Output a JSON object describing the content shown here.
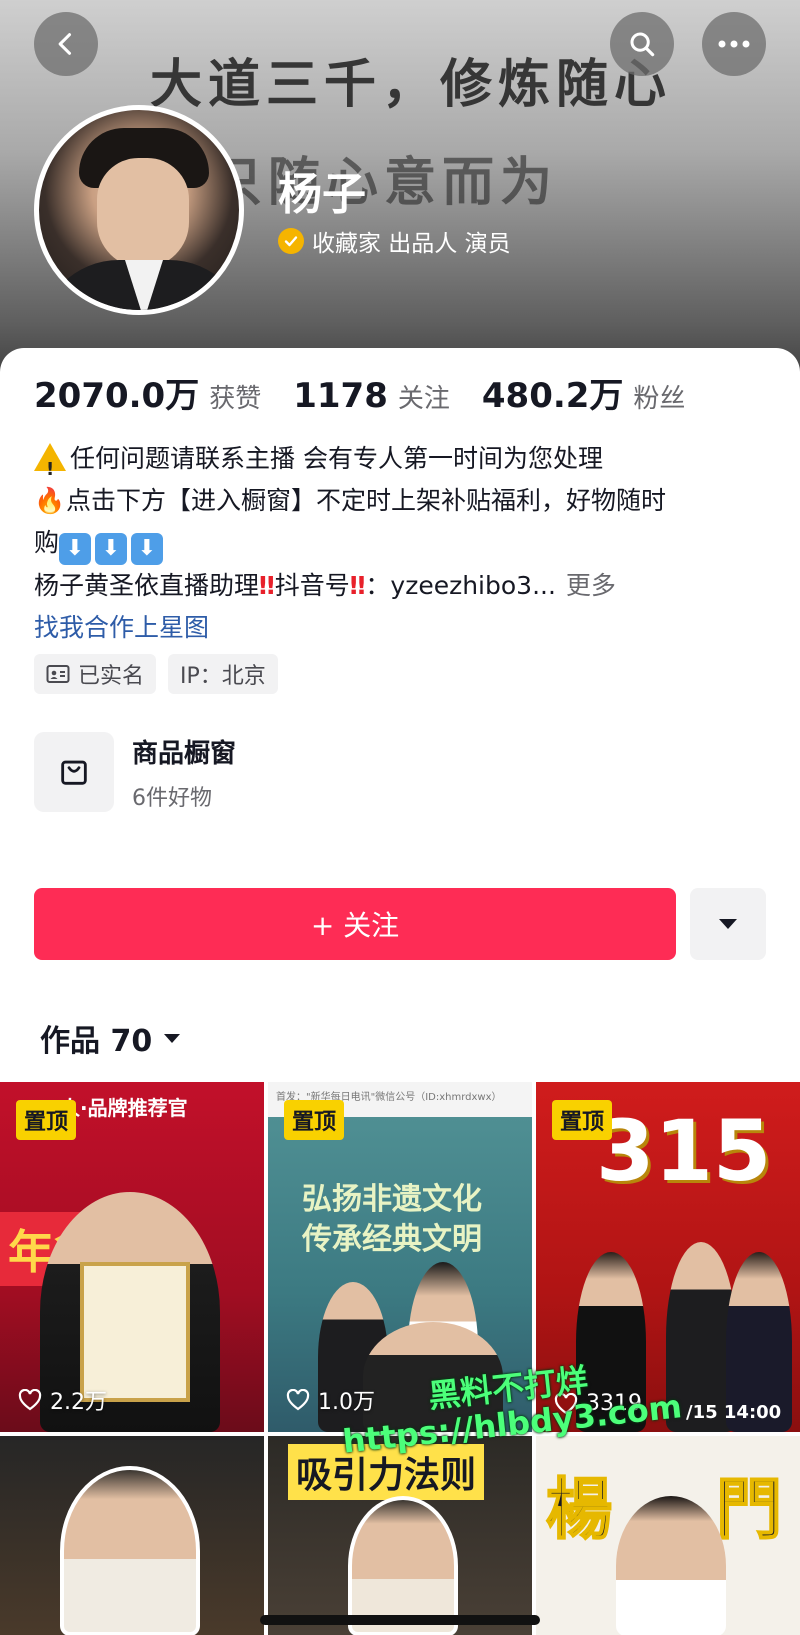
{
  "header": {
    "banner_line1": "大道三千，修炼随心",
    "banner_line2": "只随心意而为",
    "name": "杨子",
    "tags": "收藏家 出品人 演员"
  },
  "stats": [
    {
      "num": "2070.0万",
      "label": "获赞"
    },
    {
      "num": "1178",
      "label": "关注"
    },
    {
      "num": "480.2万",
      "label": "粉丝"
    }
  ],
  "bio": {
    "line1": "任何问题请联系主播 会有专人第一时间为您处理",
    "line2": "点击下方【进入橱窗】不定时上架补贴福利，好物随时",
    "line3_prefix": "购",
    "line4_a": "杨子黄圣依直播助理",
    "line4_b": "抖音号",
    "line4_c": "：yzeezhibo3...",
    "more": "更多",
    "star_link": "找我合作上星图"
  },
  "chips": {
    "verified": "已实名",
    "ip": "IP：北京"
  },
  "shop": {
    "title": "商品橱窗",
    "subtitle": "6件好物"
  },
  "follow_button": "+ 关注",
  "works_tab": "作品 70",
  "grid": {
    "pin_label": "置顶",
    "tiles": [
      {
        "likes": "2.2万",
        "caption": "人·品牌推荐官",
        "caption2": "年货节"
      },
      {
        "likes": "1.0万",
        "header": "首发：\"新华每日电讯\"微信公号（ID:xhmrdxwx）",
        "caption": "弘扬非遗文化",
        "caption2": "传承经典文明"
      },
      {
        "likes": "3319",
        "caption": "315",
        "caption2": "/15 14:00"
      },
      {
        "caption": ""
      },
      {
        "caption": "吸引力法则"
      },
      {
        "caption": "楊",
        "caption2": "門"
      }
    ]
  },
  "watermark": {
    "line1": "黑料不打烊",
    "line2": "https://hlbdy3.com"
  }
}
